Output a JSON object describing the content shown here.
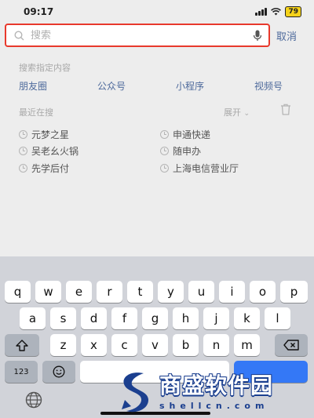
{
  "status_bar": {
    "time": "09:17",
    "battery": "79"
  },
  "search": {
    "placeholder": "搜索",
    "cancel_label": "取消"
  },
  "specify_section": {
    "title": "搜索指定内容",
    "categories": [
      "朋友圈",
      "公众号",
      "小程序",
      "视频号"
    ]
  },
  "recent_section": {
    "title": "最近在搜",
    "expand_label": "展开",
    "left_items": [
      "元梦之星",
      "吴老幺火锅",
      "先学后付"
    ],
    "right_items": [
      "申通快递",
      "随申办",
      "上海电信营业厅"
    ]
  },
  "keyboard": {
    "row1": [
      "q",
      "w",
      "e",
      "r",
      "t",
      "y",
      "u",
      "i",
      "o",
      "p"
    ],
    "row2": [
      "a",
      "s",
      "d",
      "f",
      "g",
      "h",
      "j",
      "k",
      "l"
    ],
    "row3": [
      "z",
      "x",
      "c",
      "v",
      "b",
      "n",
      "m"
    ],
    "numbers_label": "123"
  },
  "watermark": {
    "brand": "商盛软件园",
    "domain": "shellcn.com"
  },
  "colors": {
    "accent_link": "#4e6a9c",
    "highlight_border": "#e8392c",
    "battery": "#f5d21a"
  }
}
